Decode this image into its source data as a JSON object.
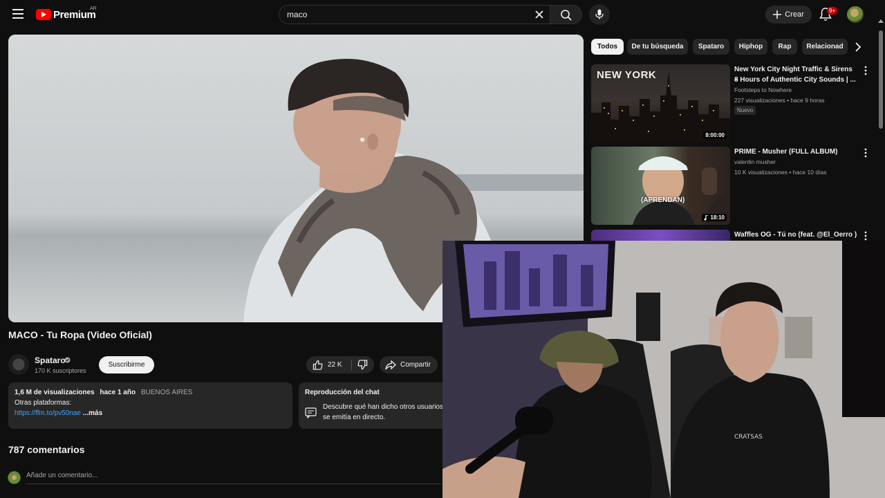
{
  "header": {
    "logo_text": "Premium",
    "country_code": "AR",
    "search_value": "maco",
    "create_label": "Crear",
    "notifications_badge": "9+"
  },
  "video": {
    "title": "MACO - Tu Ropa (Video Oficial)",
    "channel_name": "Spataro",
    "subscribers": "170 K suscriptores",
    "subscribe_label": "Suscribirme",
    "likes": "22 K",
    "share_label": "Compartir",
    "views": "1,6 M de visualizaciones",
    "age": "hace 1 año",
    "location": "BUENOS AIRES",
    "description_line": "Otras plataformas:",
    "description_link": "https://ffm.to/pv50nae",
    "more_label": "...más"
  },
  "chat_replay": {
    "title": "Reproducción del chat",
    "text_line1": "Descubre qué han dicho otros usuarios",
    "text_line2": "se emitía en directo."
  },
  "comments": {
    "count_label": "787 comentarios",
    "placeholder": "Añade un comentario..."
  },
  "chips": [
    "Todos",
    "De tu búsqueda",
    "Spataro",
    "Hiphop",
    "Rap",
    "Relacionad"
  ],
  "related": [
    {
      "title_line1": "New York City Night Traffic & Sirens –",
      "title_line2": "8 Hours of Authentic City Sounds | ...",
      "channel": "Footsteps to Nowhere",
      "meta": "227 visualizaciones • hace 9 horas",
      "badge": "Nuevo",
      "duration": "8:00:00",
      "thumb_text": "NEW YORK"
    },
    {
      "title_line1": "PRIME - Musher (FULL ALBUM)",
      "channel": "valentin musher",
      "meta": "10 K visualizaciones • hace 10 días",
      "duration": "18:10",
      "thumb_text": "(APRENDAN)"
    },
    {
      "title_line1": "Waffles OG - Tú no (feat. @El_Oerro )"
    }
  ],
  "colors": {
    "background": "#0f0f0f",
    "surface": "#272727",
    "brand_red": "#ff0000",
    "link_blue": "#3ea6ff",
    "badge_red": "#cc0000"
  }
}
